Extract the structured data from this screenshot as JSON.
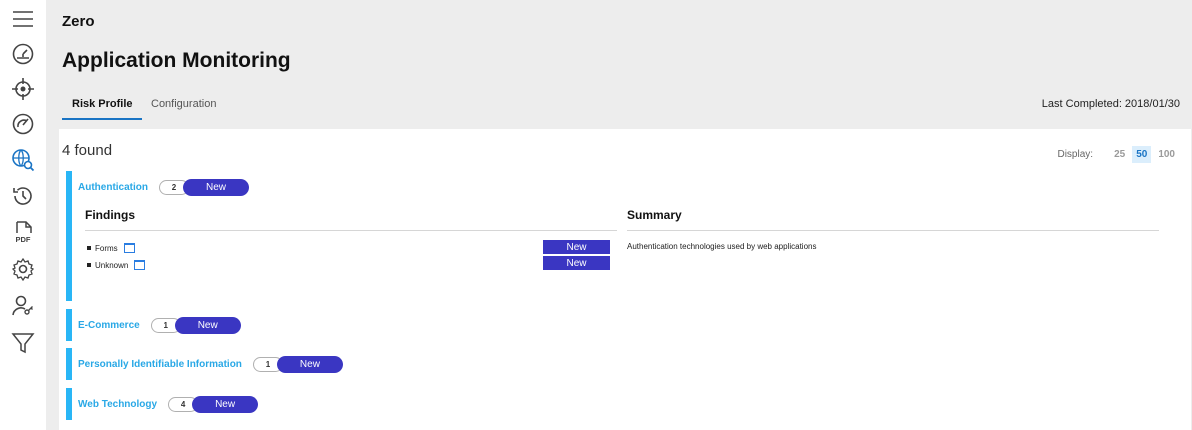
{
  "sidebar": {
    "items": [
      {
        "icon": "menu-icon"
      },
      {
        "icon": "dashboard-icon"
      },
      {
        "icon": "crosshair-icon"
      },
      {
        "icon": "gauge-icon"
      },
      {
        "icon": "globe-search-icon"
      },
      {
        "icon": "history-icon"
      },
      {
        "icon": "pdf-icon",
        "label": "PDF"
      },
      {
        "icon": "settings-icon"
      },
      {
        "icon": "user-key-icon"
      },
      {
        "icon": "filter-icon"
      }
    ]
  },
  "header": {
    "app_name": "Zero",
    "title": "Application Monitoring",
    "tabs": [
      {
        "label": "Risk Profile",
        "active": true
      },
      {
        "label": "Configuration",
        "active": false
      }
    ],
    "last_completed": "Last Completed: 2018/01/30"
  },
  "results": {
    "found": "4 found",
    "display_label": "Display:",
    "page_sizes": [
      "25",
      "50",
      "100"
    ],
    "active_page_size": "50"
  },
  "categories": [
    {
      "name": "Authentication",
      "count": "2",
      "status": "New",
      "expanded": true,
      "findings_title": "Findings",
      "summary_title": "Summary",
      "findings": [
        {
          "label": "Forms",
          "status": "New"
        },
        {
          "label": "Unknown",
          "status": "New"
        }
      ],
      "summary": "Authentication technologies used by web applications"
    },
    {
      "name": "E-Commerce",
      "count": "1",
      "status": "New",
      "expanded": false
    },
    {
      "name": "Personally Identifiable Information",
      "count": "1",
      "status": "New",
      "expanded": false
    },
    {
      "name": "Web Technology",
      "count": "4",
      "status": "New",
      "expanded": false
    }
  ],
  "colors": {
    "accent": "#29b6f6",
    "status_new": "#3a36c2",
    "tab_underline": "#1a74c4",
    "background": "#ededed"
  }
}
